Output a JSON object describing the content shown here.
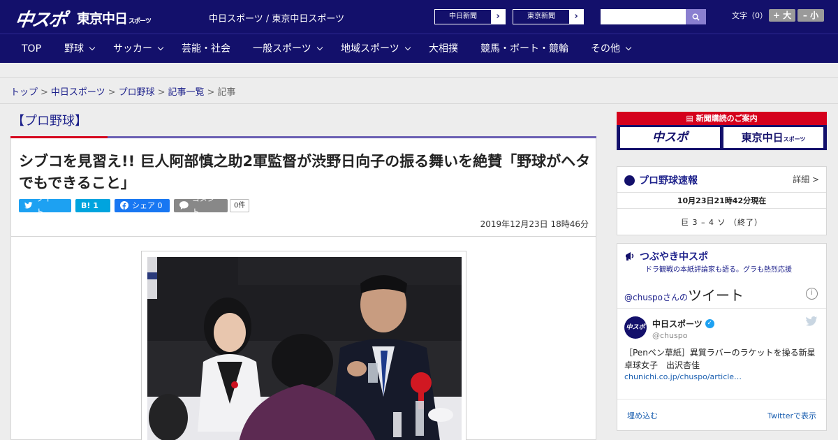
{
  "header": {
    "logo_chuspo": "中スポ",
    "logo_tokyo": "東京中日",
    "logo_tokyo_small": "スポーツ",
    "site_name": "中日スポーツ / 東京中日スポーツ",
    "ext_links": [
      "中日新聞",
      "東京新聞"
    ],
    "search_placeholder": "",
    "font_label": "文字（0）",
    "font_plus": "+ 大",
    "font_minus": "– 小"
  },
  "nav": {
    "items": [
      {
        "label": "TOP",
        "chevron": false
      },
      {
        "label": "野球",
        "chevron": true
      },
      {
        "label": "サッカー",
        "chevron": true
      },
      {
        "label": "芸能・社会",
        "chevron": false
      },
      {
        "label": "一般スポーツ",
        "chevron": true
      },
      {
        "label": "地域スポーツ",
        "chevron": true
      },
      {
        "label": "大相撲",
        "chevron": false
      },
      {
        "label": "競馬・ボート・競輪",
        "chevron": false
      },
      {
        "label": "その他",
        "chevron": true
      }
    ]
  },
  "breadcrumb": {
    "items": [
      "トップ",
      "中日スポーツ",
      "プロ野球",
      "記事一覧"
    ],
    "current": "記事",
    "sep": ">"
  },
  "article": {
    "category": "【プロ野球】",
    "headline": "シブコを見習え!! 巨人阿部慎之助2軍監督が渋野日向子の振る舞いを絶賛「野球がヘタでもできること」",
    "share": {
      "tweet": "ツイート",
      "hatena": "B! 1",
      "facebook": "シェア 0",
      "comment": "コメント",
      "comment_count": "0件"
    },
    "date": "2019年12月23日 18時46分"
  },
  "sidebar": {
    "subscription": {
      "title": "新聞購読のご案内",
      "btn1": "中スポ",
      "btn2": "東京中日",
      "btn2_small": "スポーツ"
    },
    "score": {
      "title": "プロ野球速報",
      "more": "詳細 >",
      "time": "10月23日21時42分現在",
      "result": "巨 3 – 4 ソ （終了）"
    },
    "tweets": {
      "title": "つぶやき中スポ",
      "subtitle": "ドラ観戦の本紙評論家も語る。グラも熱烈応援",
      "handle_prefix": "@chuspo",
      "handle_suffix": "さんの",
      "heading": "ツイート",
      "avatar_text": "中スポ",
      "name": "中日スポーツ",
      "handle": "@chuspo",
      "text": "［Penペン草紙］異質ラバーのラケットを操る新星　卓球女子　出沢杏佳",
      "link": "chunichi.co.jp/chuspo/article…",
      "embed": "埋め込む",
      "view": "Twitterで表示"
    }
  },
  "colors": {
    "brand_navy": "#13106b",
    "accent_red": "#d5001c",
    "accent_purple": "#6b5fb3",
    "twitter": "#1da1f2",
    "facebook": "#1877f2"
  }
}
